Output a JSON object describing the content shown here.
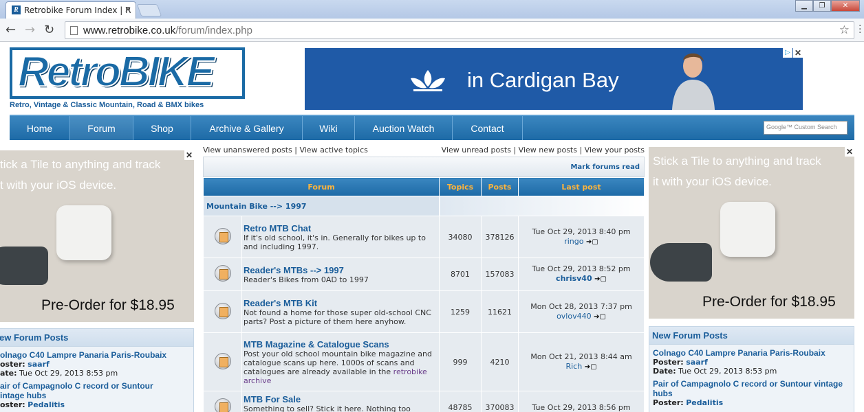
{
  "browser": {
    "tab_title": "Retrobike Forum Index | R",
    "favicon_letter": "R",
    "url_domain": "www.retrobike.co.uk",
    "url_path": "/forum/index.php"
  },
  "header": {
    "logo_text": "RetroBIKE",
    "tagline": "Retro, Vintage & Classic Mountain, Road & BMX bikes",
    "banner_text": "in Cardigan Bay"
  },
  "nav": {
    "items": [
      "Home",
      "Forum",
      "Shop",
      "Archive & Gallery",
      "Wiki",
      "Auction Watch",
      "Contact"
    ],
    "search_placeholder": "Google™ Custom Search"
  },
  "side_ad": {
    "line1": "Stick a Tile to anything and track",
    "line2": "it with your iOS device.",
    "line1_left": "tick a Tile to anything and track",
    "line2_left": "t with your iOS device.",
    "price": "Pre-Order for $18.95"
  },
  "new_posts": {
    "title": "New Forum Posts",
    "title_left": "ew Forum Posts",
    "posts": [
      {
        "title": "Colnago C40 Lampre Panaria Paris-Roubaix",
        "poster": "saarf",
        "date": "Tue Oct 29, 2013 8:53 pm"
      },
      {
        "title": "Pair of Campagnolo C record or Suntour vintage hubs",
        "poster": "Pedalitis",
        "date": ""
      }
    ],
    "left_posts": [
      {
        "title": "olnago C40 Lampre Panaria Paris-Roubaix",
        "poster_label": "oster:",
        "poster": "saarf",
        "date_label": "ate:",
        "date": "Tue Oct 29, 2013 8:53 pm"
      },
      {
        "title": "air of Campagnolo C record or Suntour",
        "title2": "intage hubs",
        "poster_label": "oster:",
        "poster": "Pedalitis"
      }
    ],
    "poster_label": "Poster:",
    "date_label": "Date:"
  },
  "forum": {
    "links_left": "View unanswered posts | View active topics",
    "links_right": "View unread posts | View new posts | View your posts",
    "mark_read": "Mark forums read",
    "headers": {
      "forum": "Forum",
      "topics": "Topics",
      "posts": "Posts",
      "last": "Last post"
    },
    "category": "Mountain Bike --> 1997",
    "rows": [
      {
        "title": "Retro MTB Chat",
        "desc": "If it's old school, it's in. Generally for bikes up to and including 1997.",
        "topics": "34080",
        "posts": "378126",
        "last_date": "Tue Oct 29, 2013 8:40 pm",
        "last_user": "ringo"
      },
      {
        "title": "Reader's MTBs --> 1997",
        "desc": "Reader's Bikes from 0AD to 1997",
        "topics": "8701",
        "posts": "157083",
        "last_date": "Tue Oct 29, 2013 8:52 pm",
        "last_user": "chrisv40"
      },
      {
        "title": "Reader's MTB Kit",
        "desc": "Not found a home for those super old-school CNC parts? Post a picture of them here anyhow.",
        "topics": "1259",
        "posts": "11621",
        "last_date": "Mon Oct 28, 2013 7:37 pm",
        "last_user": "ovlov440"
      },
      {
        "title": "MTB Magazine & Catalogue Scans",
        "desc": "Post your old school mountain bike magazine and catalogue scans up here. 1000s of scans and catalogues are already available in the",
        "desc_link": "retrobike archive",
        "topics": "999",
        "posts": "4210",
        "last_date": "Mon Oct 21, 2013 8:44 am",
        "last_user": "Rich"
      },
      {
        "title": "MTB For Sale",
        "desc": "Something to sell? Stick it here. Nothing too",
        "topics": "48785",
        "posts": "370083",
        "last_date": "Tue Oct 29, 2013 8:56 pm",
        "last_user": ""
      }
    ]
  },
  "colors": {
    "accent": "#1a5d9a",
    "nav": "#1d6aa6",
    "header_text": "#ffb43c"
  }
}
